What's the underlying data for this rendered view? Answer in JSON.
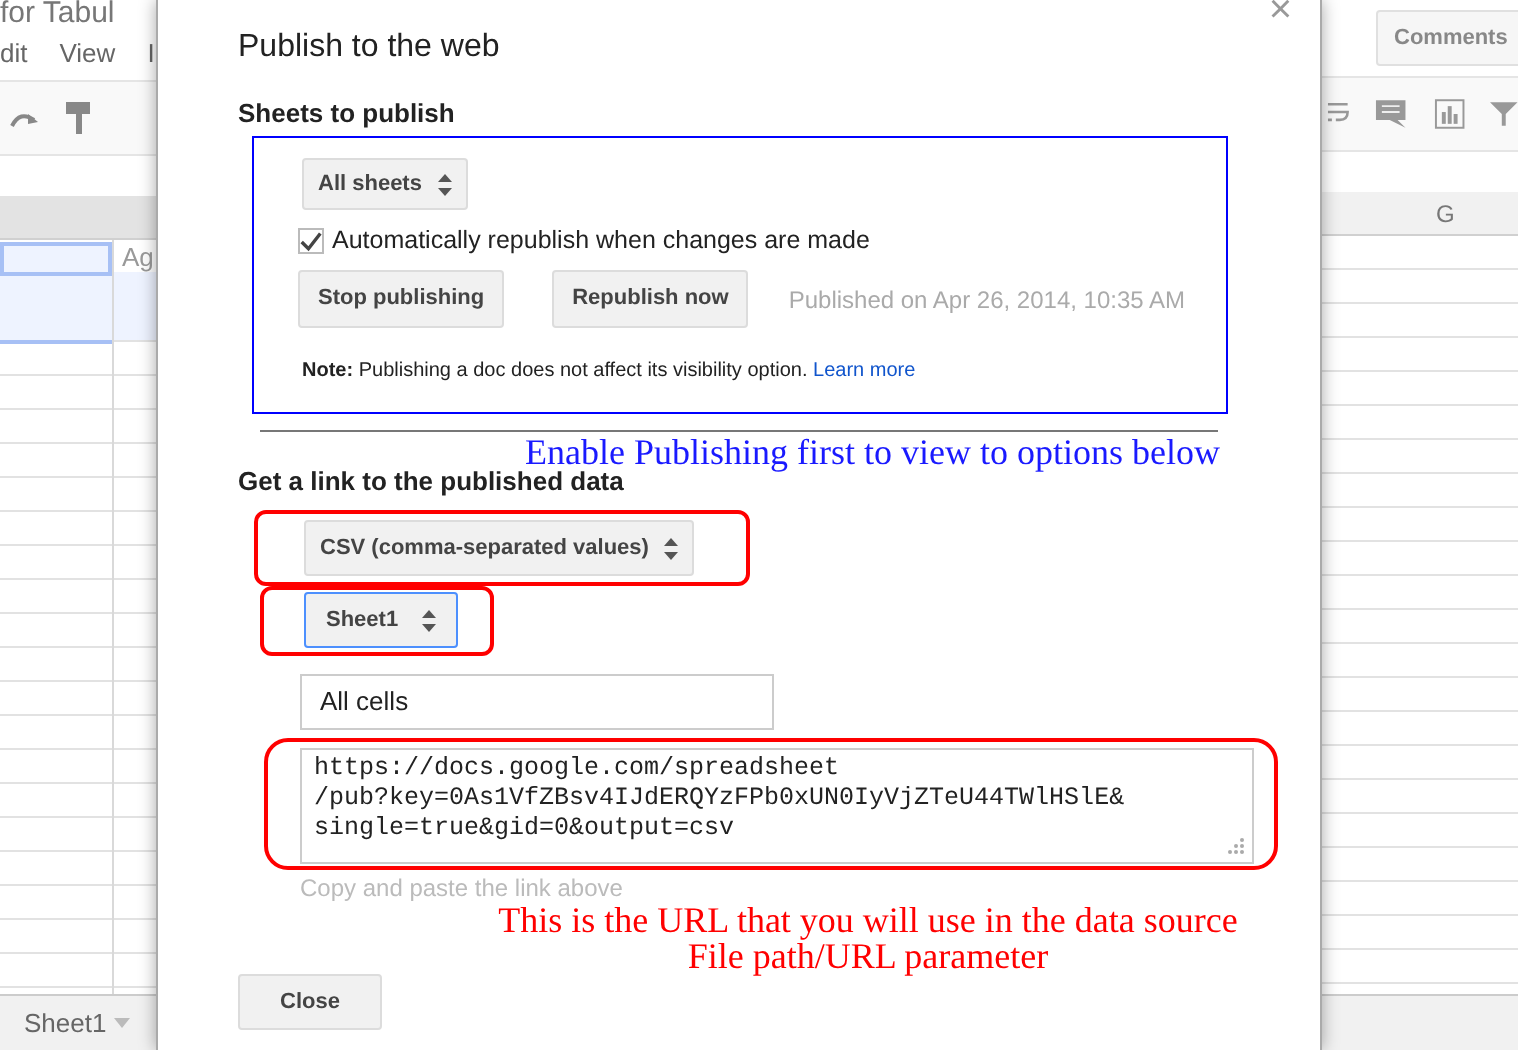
{
  "spreadsheet": {
    "doc_title": "for Tabul",
    "menu": [
      "dit",
      "View",
      "I"
    ],
    "cell_text": "Ag",
    "comments_button": "Comments",
    "column_header": "G",
    "sheet_tab": "Sheet1"
  },
  "dialog": {
    "title": "Publish to the web",
    "close_icon": "×",
    "sheets_section": {
      "heading": "Sheets to publish",
      "sheet_select": "All sheets",
      "auto_republish": {
        "label": "Automatically republish when changes are made",
        "checked": true
      },
      "buttons": [
        "Stop publishing",
        "Republish now"
      ],
      "published_status": "Published on Apr 26, 2014, 10:35 AM",
      "note": "**Note:** Publishing a doc does not affect its visibility option.",
      "note_link": "Learn more"
    },
    "publishing_annotation": "Enable Publishing first to view to options below",
    "link_section": {
      "heading": "Get a link to the published data",
      "format_select": "CSV (comma-separated values)",
      "sheet_select": "Sheet1",
      "range_field": "All cells",
      "url_lines": [
        "https://docs.google.com/spreadsheet",
        "/pub?key=0As1VfZBsv4IJdERQYzFPb0xUN0IyVjZTeU44TWlHSlE&",
        "single=true&gid=0&output=csv"
      ],
      "hint": "Copy and paste the link above"
    },
    "url_annotation": [
      "This is the URL that you will use in the data source",
      "File path/URL parameter"
    ],
    "close_button": "Close"
  }
}
